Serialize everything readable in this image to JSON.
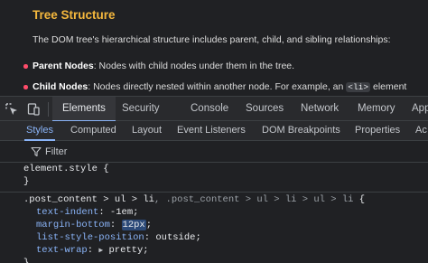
{
  "article": {
    "title": "Tree Structure",
    "paragraph": "The DOM tree's hierarchical structure includes parent, child, and sibling relationships:",
    "bullets": [
      {
        "term": "Parent Nodes",
        "text": ": Nodes with child nodes under them in the tree."
      },
      {
        "term": "Child Nodes",
        "text_before": ": Nodes directly nested within another node. For example, an ",
        "code": "<li>",
        "text_after": " element"
      }
    ]
  },
  "devtools": {
    "tabs": [
      "Elements",
      "Security",
      "Console",
      "Sources",
      "Network",
      "Memory",
      "App"
    ],
    "active_tab": "Elements",
    "subtabs": [
      "Styles",
      "Computed",
      "Layout",
      "Event Listeners",
      "DOM Breakpoints",
      "Properties",
      "Ac"
    ],
    "active_subtab": "Styles",
    "filter": {
      "placeholder": "Filter",
      "value": ""
    },
    "element_style": {
      "selector": "element.style",
      "open": " {",
      "close": "}"
    },
    "rule": {
      "selector_main": ".post_content > ul > li",
      "selector_rest": ", .post_content > ul > li > ul > li",
      "open": " {",
      "declarations": [
        {
          "prop": "text-indent",
          "value": "-1em"
        },
        {
          "prop": "margin-bottom",
          "value": "12px",
          "highlighted": true
        },
        {
          "prop": "list-style-position",
          "value": "outside"
        },
        {
          "prop": "text-wrap",
          "value": "pretty",
          "expandable": true
        }
      ],
      "close": "}"
    }
  },
  "colors": {
    "heading": "#f5b83d",
    "bullet": "#ff4c6a",
    "accent": "#8ab4f8",
    "panel": "#292a2d",
    "background": "#202124"
  },
  "icons": [
    "select-element-icon",
    "device-toolbar-icon",
    "filter-icon",
    "expand-triangle-icon"
  ]
}
